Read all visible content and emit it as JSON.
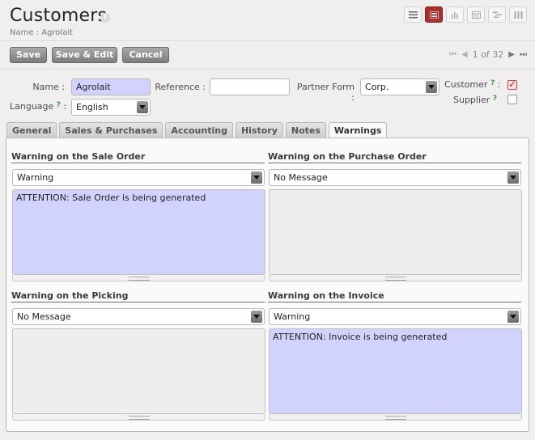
{
  "header": {
    "title": "Customers",
    "help": "?",
    "subtitle": "Name : Agrolait"
  },
  "view_switcher": [
    {
      "name": "list-view",
      "icon": "list-icon",
      "active": false
    },
    {
      "name": "form-view",
      "icon": "form-icon",
      "active": true
    },
    {
      "name": "graph-view",
      "icon": "bar-chart-icon",
      "active": false
    },
    {
      "name": "calendar-view",
      "icon": "calendar-icon",
      "active": false
    },
    {
      "name": "gantt-view",
      "icon": "gantt-icon",
      "active": false
    },
    {
      "name": "kanban-view",
      "icon": "kanban-icon",
      "active": false
    }
  ],
  "toolbar": {
    "save_label": "Save",
    "save_edit_label": "Save & Edit",
    "cancel_label": "Cancel"
  },
  "pager": {
    "text": "1 of 32"
  },
  "form": {
    "name_label": "Name :",
    "name_value": "Agrolait",
    "reference_label": "Reference :",
    "reference_value": "",
    "partner_form_label": "Partner Form :",
    "partner_form_value": "Corp.",
    "customer_label": "Customer",
    "customer_checked": true,
    "supplier_label": "Supplier",
    "supplier_checked": false,
    "language_label": "Language",
    "language_value": "English",
    "help_mark": "?",
    "colon": ":"
  },
  "tabs": [
    {
      "label": "General",
      "active": false
    },
    {
      "label": "Sales & Purchases",
      "active": false
    },
    {
      "label": "Accounting",
      "active": false
    },
    {
      "label": "History",
      "active": false
    },
    {
      "label": "Notes",
      "active": false
    },
    {
      "label": "Warnings",
      "active": true
    }
  ],
  "warnings": {
    "sale": {
      "title": "Warning on the Sale Order",
      "select": "Warning",
      "message": "ATTENTION: Sale Order is being generated"
    },
    "purchase": {
      "title": "Warning on the Purchase Order",
      "select": "No Message",
      "message": ""
    },
    "picking": {
      "title": "Warning on the Picking",
      "select": "No Message",
      "message": ""
    },
    "invoice": {
      "title": "Warning on the Invoice",
      "select": "Warning",
      "message": "ATTENTION: Invoice is being generated"
    }
  },
  "colors": {
    "accent": "#a8302e",
    "required_field": "#d2d2ff",
    "help_green": "#3c9a3c"
  }
}
